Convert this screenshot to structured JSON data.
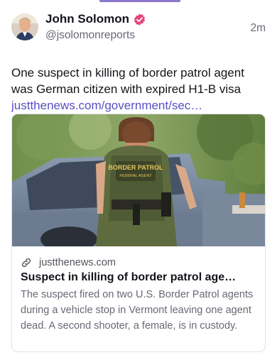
{
  "post": {
    "author_name": "John Solomon",
    "author_handle": "@jsolomonreports",
    "timestamp": "2m",
    "text": "One suspect in killing of border patrol agent was German citizen with expired H1-B visa",
    "link_text": "justthenews.com/government/sec…",
    "verified_icon": "verified-badge-icon",
    "accent_color": "#5a4fc6"
  },
  "card": {
    "domain": "justthenews.com",
    "title": "Suspect in killing of border patrol age…",
    "description": "The suspect fired on two U.S. Border Patrol agents during a vehicle stop in Vermont leaving one agent dead. A second shooter, a female, is in custody.",
    "image_patch_text": "BORDER PATROL",
    "image_patch_subtext": "FEDERAL AGENT",
    "link_icon": "link-icon"
  },
  "colors": {
    "verified_badge": "#e5457a",
    "link": "#5a4fc6",
    "secondary_text": "#6a6875"
  }
}
